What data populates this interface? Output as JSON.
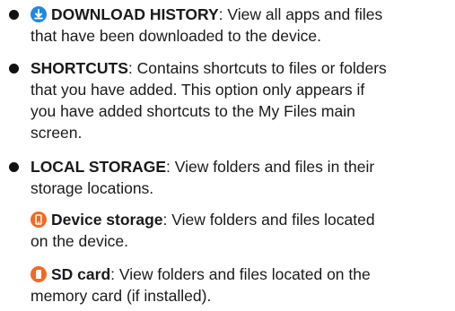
{
  "items": [
    {
      "title": "DOWNLOAD HISTORY",
      "icon": "download-icon",
      "line1_rest": ": View all apps and files",
      "line2": "that have been downloaded to the device."
    },
    {
      "title": "SHORTCUTS",
      "line1_rest": ": Contains shortcuts to files or folders",
      "line2": "that you have added. This option only appears if",
      "line3": "you have added shortcuts to the My Files main",
      "line4": "screen."
    },
    {
      "title": "LOCAL STORAGE",
      "line1_rest": ": View folders and files in their",
      "line2": "storage locations.",
      "subitems": [
        {
          "title": "Device storage",
          "icon": "device-storage-icon",
          "line1_rest": ": View folders and files located",
          "line2": "on the device."
        },
        {
          "title": "SD card",
          "icon": "sd-card-icon",
          "line1_rest": ": View folders and files located on the",
          "line2": "memory card (if installed)."
        }
      ]
    }
  ],
  "colors": {
    "download_icon": "#1e88e5",
    "storage_icon": "#f26a22",
    "text": "#1a1a1a"
  }
}
